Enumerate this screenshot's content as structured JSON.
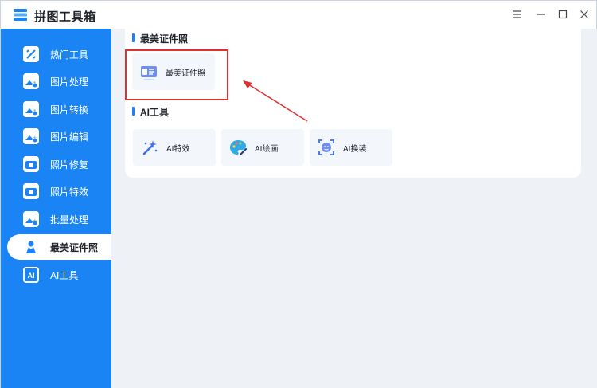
{
  "app": {
    "title": "拼图工具箱",
    "window_controls": [
      "menu",
      "minimize",
      "maximize",
      "close"
    ]
  },
  "sidebar": {
    "items": [
      {
        "label": "热门工具",
        "icon": "hot-tools-icon",
        "active": false
      },
      {
        "label": "图片处理",
        "icon": "image-process-icon",
        "active": false
      },
      {
        "label": "图片转换",
        "icon": "image-convert-icon",
        "active": false
      },
      {
        "label": "图片编辑",
        "icon": "image-edit-icon",
        "active": false
      },
      {
        "label": "照片修复",
        "icon": "photo-repair-icon",
        "active": false
      },
      {
        "label": "照片特效",
        "icon": "photo-effect-icon",
        "active": false
      },
      {
        "label": "批量处理",
        "icon": "batch-process-icon",
        "active": false
      },
      {
        "label": "最美证件照",
        "icon": "id-photo-icon",
        "active": true
      },
      {
        "label": "AI工具",
        "icon": "ai-tools-icon",
        "active": false
      }
    ]
  },
  "main": {
    "sections": [
      {
        "title": "最美证件照",
        "cards": [
          {
            "label": "最美证件照",
            "icon": "id-card-icon"
          }
        ]
      },
      {
        "title": "AI工具",
        "cards": [
          {
            "label": "AI特效",
            "icon": "magic-wand-icon"
          },
          {
            "label": "AI绘画",
            "icon": "palette-icon"
          },
          {
            "label": "AI换装",
            "icon": "face-swap-icon"
          }
        ]
      }
    ]
  },
  "colors": {
    "accent": "#1b84f5",
    "highlight": "#e03131",
    "background": "#eef2f7"
  }
}
